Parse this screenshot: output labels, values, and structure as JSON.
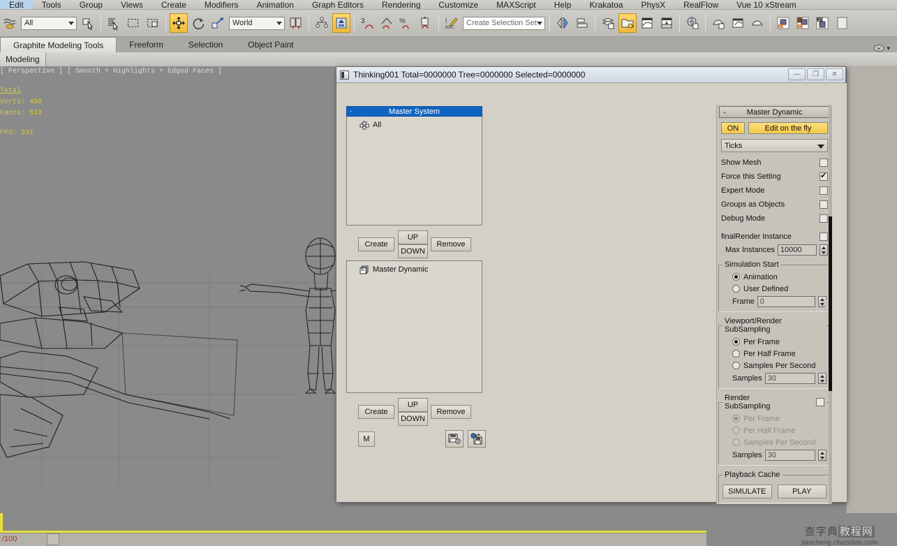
{
  "menubar": {
    "items": [
      {
        "label": "Edit"
      },
      {
        "label": "Tools"
      },
      {
        "label": "Group"
      },
      {
        "label": "Views"
      },
      {
        "label": "Create"
      },
      {
        "label": "Modifiers"
      },
      {
        "label": "Animation"
      },
      {
        "label": "Graph Editors"
      },
      {
        "label": "Rendering"
      },
      {
        "label": "Customize"
      },
      {
        "label": "MAXScript"
      },
      {
        "label": "Help"
      },
      {
        "label": "Krakatoa"
      },
      {
        "label": "PhysX"
      },
      {
        "label": "RealFlow"
      },
      {
        "label": "Vue 10 xStream"
      }
    ]
  },
  "toolbar": {
    "selection_filter_value": "All",
    "reference_coord_value": "World",
    "selection_set_placeholder": "Create Selection Set",
    "icons": [
      "undo-redo-icon",
      "select-object-icon",
      "select-by-name-icon",
      "rectangular-selection-region-icon",
      "window-crossing-icon",
      "select-and-move-icon",
      "select-and-rotate-icon",
      "select-and-scale-icon",
      "use-pivot-center-icon",
      "select-and-link-icon",
      "snaps-toggle-3d-icon",
      "angle-snap-toggle-icon",
      "percent-snap-toggle-icon",
      "spinner-snap-toggle-icon",
      "named-selection-sets-icon",
      "mirror-icon",
      "align-icon",
      "layer-manager-icon",
      "graphite-modeling-toggle-icon",
      "curve-editor-icon",
      "schematic-view-icon",
      "material-editor-icon",
      "render-setup-icon",
      "rendered-frame-window-icon",
      "render-production-icon",
      "vue-render-icon",
      "vue-atmosphere-icon",
      "vue-object-icon",
      "vue-extra-icon"
    ]
  },
  "ribbon": {
    "tabs": [
      {
        "label": "Graphite Modeling Tools",
        "selected": true
      },
      {
        "label": "Freeform",
        "selected": false
      },
      {
        "label": "Selection",
        "selected": false
      },
      {
        "label": "Object Paint",
        "selected": false
      }
    ],
    "subtab": "Modeling"
  },
  "viewport": {
    "label": "[ Perspective ] [ Smooth + Highlights + Edged Faces ]",
    "stats_title": "Total",
    "stats": [
      "Verts: 450",
      "Faces: 533"
    ],
    "stats_extra": "FPS: 331"
  },
  "dialog": {
    "icon": "thinking-particles-icon",
    "title": "Thinking001  Total=0000000  Tree=0000000  Selected=0000000",
    "window_buttons": [
      {
        "name": "minimize-button",
        "glyph": "—"
      },
      {
        "name": "maximize-button",
        "glyph": "❐"
      },
      {
        "name": "close-button",
        "glyph": "✕"
      }
    ],
    "master_system": {
      "header": "Master System",
      "collapse_glyph": "-",
      "items": [
        {
          "label": "All",
          "icon": "particle-group-icon"
        }
      ],
      "buttons": {
        "create": "Create",
        "up": "UP",
        "down": "DOWN",
        "remove": "Remove"
      }
    },
    "master_dynamic_list": {
      "items": [
        {
          "label": "Master Dynamic",
          "icon": "dynamic-set-icon"
        }
      ],
      "buttons": {
        "create": "Create",
        "up": "UP",
        "down": "DOWN",
        "remove": "Remove",
        "m": "M",
        "save_preset": "save-preset-icon",
        "load_preset": "load-preset-icon"
      }
    },
    "panel": {
      "rollout_title": "Master Dynamic",
      "collapse_glyph": "-",
      "on_button": "ON",
      "edit_button": "Edit on the fly",
      "timebase_value": "Ticks",
      "checkboxes": [
        {
          "label": "Show Mesh",
          "checked": false
        },
        {
          "label": "Force this Setting",
          "checked": true
        },
        {
          "label": "Expert Mode",
          "checked": false
        },
        {
          "label": "Groups as Objects",
          "checked": false
        },
        {
          "label": "Debug Mode",
          "checked": false
        }
      ],
      "final_render": {
        "label": "finalRender Instance",
        "checked": false
      },
      "max_instances": {
        "label": "Max Instances",
        "value": "10000"
      },
      "simulation_start": {
        "legend": "Simulation Start",
        "options": [
          {
            "label": "Animation",
            "selected": true
          },
          {
            "label": "User Defined",
            "selected": false
          }
        ],
        "frame": {
          "label": "Frame",
          "value": "0"
        }
      },
      "viewport_subsampling": {
        "legend": "Viewport/Render SubSampling",
        "options": [
          {
            "label": "Per Frame",
            "selected": true
          },
          {
            "label": "Per Half Frame",
            "selected": false
          },
          {
            "label": "Samples Per Second",
            "selected": false
          }
        ],
        "samples": {
          "label": "Samples",
          "value": "30"
        }
      },
      "render_subsampling": {
        "legend": "Render SubSampling",
        "enabled": false,
        "options": [
          {
            "label": "Per Frame",
            "selected": true
          },
          {
            "label": "Per Half Frame",
            "selected": false
          },
          {
            "label": "Samples Per Second",
            "selected": false
          }
        ],
        "samples": {
          "label": "Samples",
          "value": "30"
        }
      },
      "playback_cache": {
        "legend": "Playback Cache",
        "simulate": "SIMULATE",
        "play": "PLAY"
      }
    }
  },
  "statusbar": {
    "value": "/100"
  },
  "watermark": {
    "line1_a": "查字典",
    "line1_b": "教程网",
    "line2": "jiaocheng.chazidian.com"
  },
  "colors": {
    "accent_yellow": "#f3c84a",
    "selection_blue": "#1064c4",
    "dialog_face": "#d4d0c8",
    "viewport_bg": "#8a8a8a",
    "stats_text": "#d6cb3a"
  }
}
